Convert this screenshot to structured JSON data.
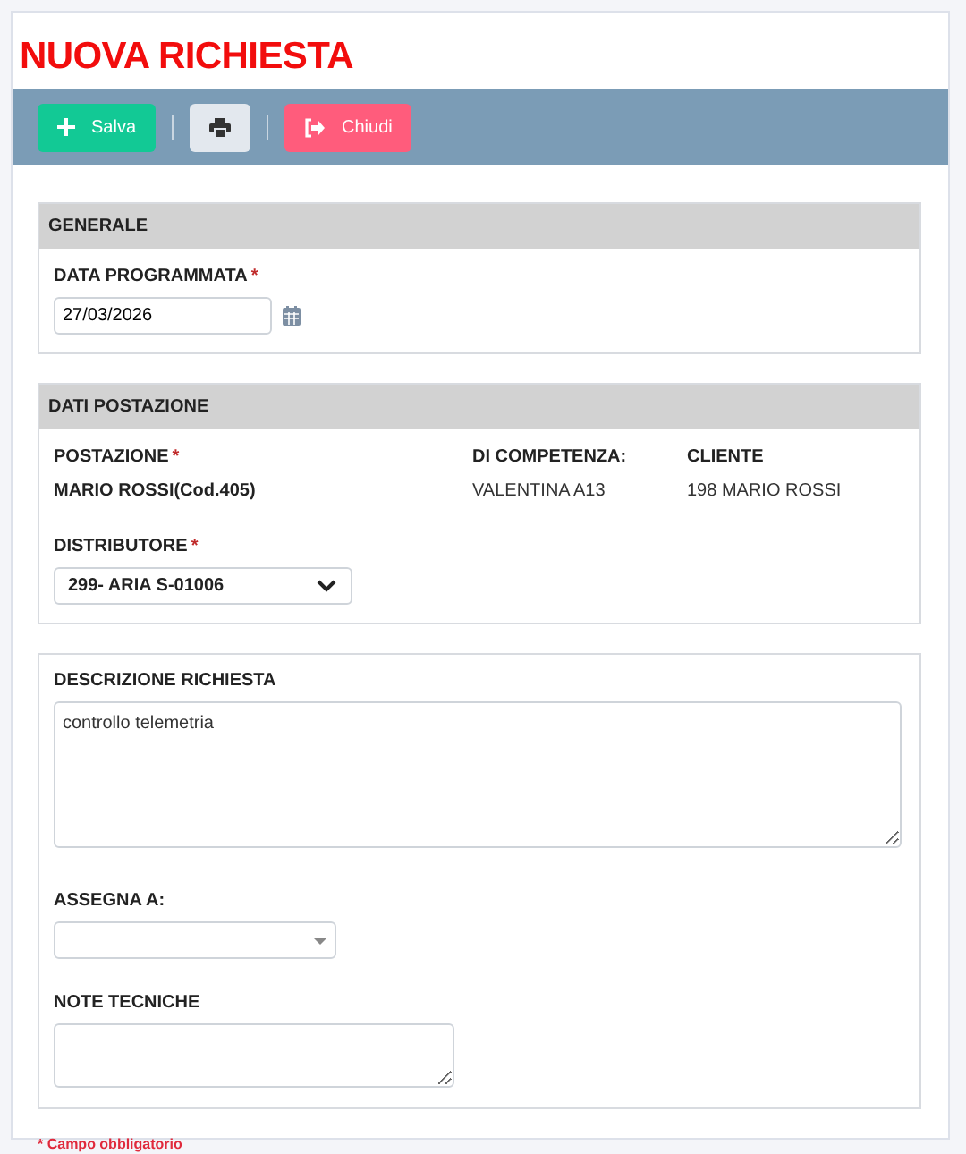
{
  "title": "NUOVA RICHIESTA",
  "toolbar": [
    {
      "kind": "save",
      "label": "Salva"
    },
    {
      "kind": "print"
    },
    {
      "kind": "close",
      "label": "Chiudi"
    }
  ],
  "generale": {
    "heading": "GENERALE",
    "date_label": "DATA PROGRAMMATA",
    "date_mark": "*",
    "date_value": "27/03/2026"
  },
  "postazione": {
    "heading": "DATI POSTAZIONE",
    "info": [
      {
        "label": "POSTAZIONE",
        "mark": "*",
        "value": "MARIO ROSSI(Cod.405)",
        "bold": true
      },
      {
        "label": "DI COMPETENZA:",
        "value": "VALENTINA A13",
        "bold": false
      },
      {
        "label": "CLIENTE",
        "value": "198 MARIO ROSSI",
        "bold": false
      }
    ],
    "distributore_label": "DISTRIBUTORE",
    "distributore_mark": "*",
    "distributore_value": "299- ARIA S-01006"
  },
  "richiesta": {
    "description_label": "DESCRIZIONE RICHIESTA",
    "description_value": "controllo telemetria",
    "assign_label": "ASSEGNA A:",
    "notes_label": "NOTE TECNICHE"
  },
  "footnote": "* Campo obbligatorio"
}
